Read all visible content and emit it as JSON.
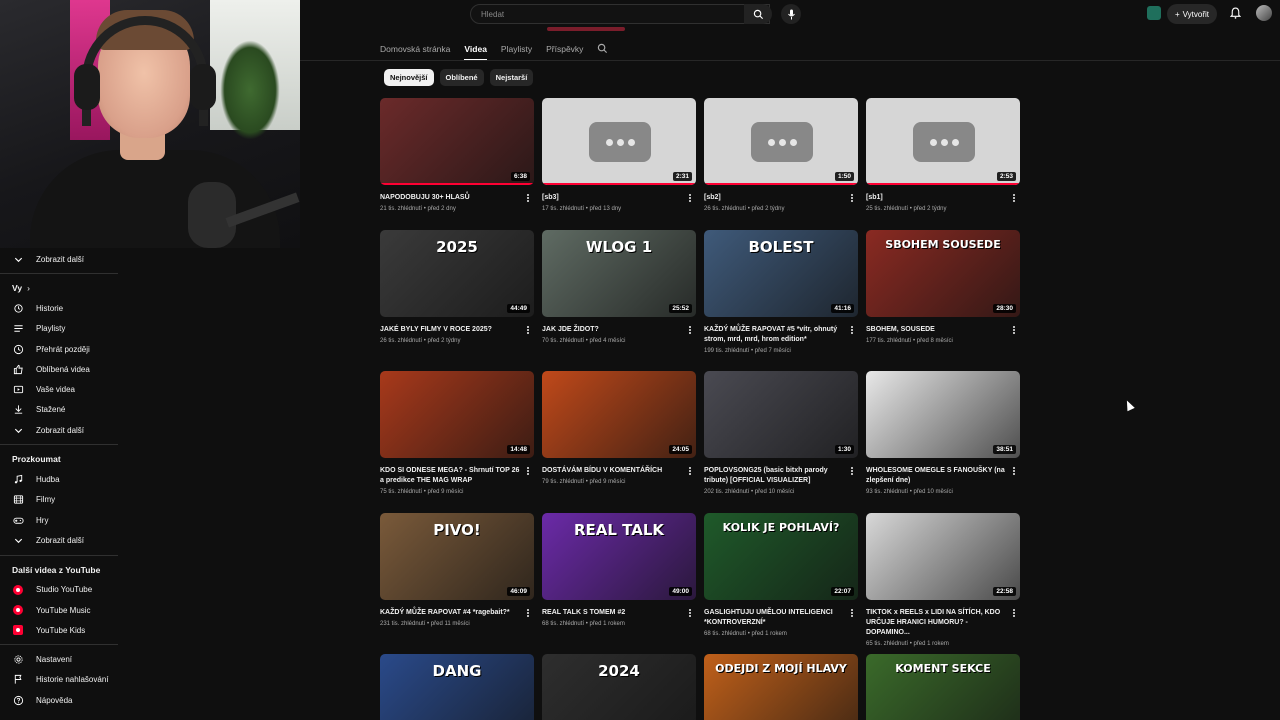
{
  "search": {
    "placeholder": "Hledat"
  },
  "header": {
    "create_label": "Vytvořit"
  },
  "channel_tabs": [
    {
      "label": "Domovská stránka"
    },
    {
      "label": "Videa"
    },
    {
      "label": "Playlisty"
    },
    {
      "label": "Příspěvky"
    }
  ],
  "chips": [
    {
      "label": "Nejnovější"
    },
    {
      "label": "Oblíbené"
    },
    {
      "label": "Nejstarší"
    }
  ],
  "sidebar": {
    "show_more_top": "Zobrazit další",
    "you_heading": "Vy",
    "you_items": [
      {
        "label": "Historie",
        "icon": "history-icon"
      },
      {
        "label": "Playlisty",
        "icon": "playlist-icon"
      },
      {
        "label": "Přehrát později",
        "icon": "clock-icon"
      },
      {
        "label": "Oblíbená videa",
        "icon": "thumbs-up-icon"
      },
      {
        "label": "Vaše videa",
        "icon": "video-icon"
      },
      {
        "label": "Stažené",
        "icon": "download-icon"
      }
    ],
    "show_more_you": "Zobrazit další",
    "explore_heading": "Prozkoumat",
    "explore_items": [
      {
        "label": "Hudba",
        "icon": "music-icon"
      },
      {
        "label": "Filmy",
        "icon": "film-icon"
      },
      {
        "label": "Hry",
        "icon": "gamepad-icon"
      }
    ],
    "show_more_explore": "Zobrazit další",
    "more_heading": "Další videa z YouTube",
    "more_items": [
      {
        "label": "Studio YouTube"
      },
      {
        "label": "YouTube Music"
      },
      {
        "label": "YouTube Kids"
      }
    ],
    "bottom_items": [
      {
        "label": "Nastavení",
        "icon": "gear-icon"
      },
      {
        "label": "Historie nahlašování",
        "icon": "flag-icon"
      },
      {
        "label": "Nápověda",
        "icon": "help-icon"
      }
    ]
  },
  "videos": [
    {
      "title": "NAPODOBUJU 30+ HLASŮ",
      "meta": "21 tis. zhlédnutí • před 2 dny",
      "duration": "6:38",
      "thumb_color": "#6b2a2a",
      "watched": 1.0
    },
    {
      "title": "[sb3]",
      "meta": "17 tis. zhlédnutí • před 13 dny",
      "duration": "2:31",
      "placeholder": true,
      "watched": 1.0
    },
    {
      "title": "[sb2]",
      "meta": "26 tis. zhlédnutí • před 2 týdny",
      "duration": "1:50",
      "placeholder": true,
      "watched": 1.0
    },
    {
      "title": "[sb1]",
      "meta": "25 tis. zhlédnutí • před 2 týdny",
      "duration": "2:53",
      "placeholder": true,
      "watched": 1.0
    },
    {
      "title": "JAKÉ BYLY FILMY V ROCE 2025?",
      "meta": "26 tis. zhlédnutí • před 2 týdny",
      "duration": "44:49",
      "thumb_color": "#3a3a3a",
      "overlay": "2025"
    },
    {
      "title": "JAK JDE ŽIDOT?",
      "meta": "70 tis. zhlédnutí • před 4 měsíci",
      "duration": "25:52",
      "thumb_color": "#5f6b63",
      "overlay": "WLOG 1"
    },
    {
      "title": "KAŽDÝ MŮŽE RAPOVAT #5 *vítr, ohnutý strom, mrd, mrd, hrom edition*",
      "meta": "199 tis. zhlédnutí • před 7 měsíci",
      "duration": "41:16",
      "thumb_color": "#3f5a7a",
      "overlay": "BOLEST"
    },
    {
      "title": "SBOHEM, SOUSEDE",
      "meta": "177 tis. zhlédnutí • před 8 měsíci",
      "duration": "28:30",
      "thumb_color": "#8a2a22",
      "overlay": "SBOHEM SOUSEDE"
    },
    {
      "title": "KDO SI ODNESE MEGA? - Shrnutí TOP 26 a predikce THE MAG WRAP",
      "meta": "75 tis. zhlédnutí • před 9 měsíci",
      "duration": "14:48",
      "thumb_color": "#a8391b"
    },
    {
      "title": "DOSTÁVÁM BÍDU V KOMENTÁŘÍCH",
      "meta": "79 tis. zhlédnutí • před 9 měsíci",
      "duration": "24:05",
      "thumb_color": "#c0491a"
    },
    {
      "title": "POPLOVSONG25 (basic bitxh parody tribute) [OFFICIAL VISUALIZER]",
      "meta": "202 tis. zhlédnutí • před 10 měsíci",
      "duration": "1:30",
      "thumb_color": "#4a4a52"
    },
    {
      "title": "WHOLESOME OMEGLE S FANOUŠKY (na zlepšení dne)",
      "meta": "93 tis. zhlédnutí • před 10 měsíci",
      "duration": "38:51",
      "thumb_color": "#e8e8e8"
    },
    {
      "title": "KAŽDÝ MŮŽE RAPOVAT #4 *ragebait?*",
      "meta": "231 tis. zhlédnutí • před 11 měsíci",
      "duration": "46:09",
      "thumb_color": "#7a5a3a",
      "overlay": "PIVO!"
    },
    {
      "title": "REAL TALK S TOMEM #2",
      "meta": "68 tis. zhlédnutí • před 1 rokem",
      "duration": "49:00",
      "thumb_color": "#6b2aa8",
      "overlay": "REAL TALK"
    },
    {
      "title": "GASLIGHTUJU UMĚLOU INTELIGENCI *KONTROVERZNÍ*",
      "meta": "68 tis. zhlédnutí • před 1 rokem",
      "duration": "22:07",
      "thumb_color": "#1f5a2a",
      "overlay": "KOLIK JE POHLAVÍ?"
    },
    {
      "title": "TIKTOK x REELS x LIDI NA SÍTÍCH, KDO URČUJE HRANICI HUMORU? - DOPAMINO...",
      "meta": "65 tis. zhlédnutí • před 1 rokem",
      "duration": "22:58",
      "thumb_color": "#d8d8d8"
    },
    {
      "title": "",
      "meta": "",
      "duration": "",
      "thumb_color": "#2a4a8a",
      "overlay": "DANG"
    },
    {
      "title": "",
      "meta": "",
      "duration": "",
      "thumb_color": "#2e2e2e",
      "overlay": "2024"
    },
    {
      "title": "",
      "meta": "",
      "duration": "",
      "thumb_color": "#c0601a",
      "overlay": "ODEJDI Z MOJÍ HLAVY"
    },
    {
      "title": "",
      "meta": "",
      "duration": "",
      "thumb_color": "#3a6a2a",
      "overlay": "KOMENT SEKCE"
    }
  ]
}
